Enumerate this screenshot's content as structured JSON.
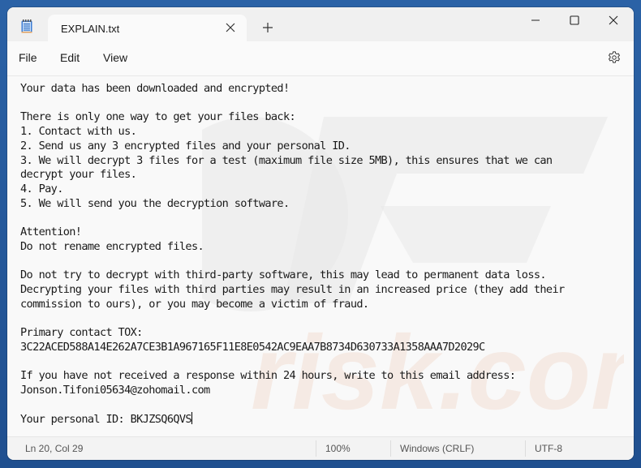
{
  "window": {
    "tab_title": "EXPLAIN.txt",
    "icons": {
      "app": "notepad-icon",
      "tab_close": "close-icon",
      "new_tab": "plus-icon",
      "minimize": "minimize-icon",
      "maximize": "maximize-icon",
      "close": "close-icon",
      "settings": "gear-icon"
    }
  },
  "menu": {
    "items": [
      "File",
      "Edit",
      "View"
    ]
  },
  "document": {
    "lines": [
      "Your data has been downloaded and encrypted!",
      "",
      "There is only one way to get your files back:",
      "1. Contact with us.",
      "2. Send us any 3 encrypted files and your personal ID.",
      "3. We will decrypt 3 files for a test (maximum file size 5MB), this ensures that we can",
      "decrypt your files.",
      "4. Pay.",
      "5. We will send you the decryption software.",
      "",
      "Attention!",
      "Do not rename encrypted files.",
      "",
      "Do not try to decrypt with third-party software, this may lead to permanent data loss.",
      "Decrypting your files with third parties may result in an increased price (they add their",
      "commission to ours), or you may become a victim of fraud.",
      "",
      "Primary contact TOX:",
      "3C22ACED588A14E262A7CE3B1A967165F11E8E0542AC9EAA7B8734D630733A1358AAA7D2029C",
      "",
      "If you have not received a response within 24 hours, write to this email address:",
      "Jonson.Tifoni05634@zohomail.com",
      "",
      "Your personal ID: BKJZSQ6QVS"
    ]
  },
  "status": {
    "position": "Ln 20, Col 29",
    "zoom": "100%",
    "line_ending": "Windows (CRLF)",
    "encoding": "UTF-8"
  },
  "colors": {
    "desktop": "#2b62a6",
    "titlebar": "#f0f0f0",
    "editor_bg": "#f9f9f9",
    "text": "#1a1a1a"
  }
}
